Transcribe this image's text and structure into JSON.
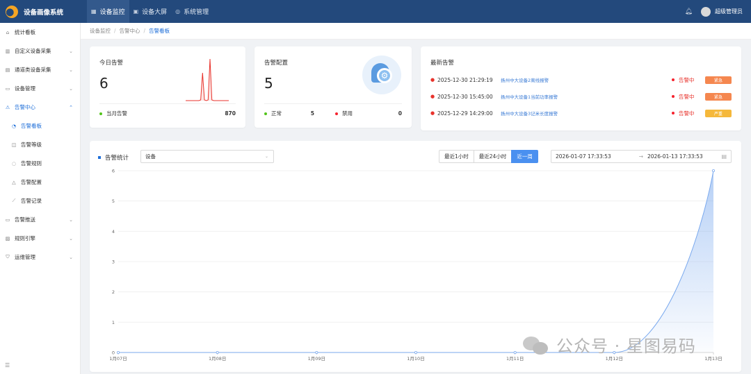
{
  "app": {
    "title": "设备画像系统",
    "user": "超级管理员"
  },
  "nav": [
    {
      "label": "设备监控",
      "icon": "grid-icon",
      "glyph": "▦",
      "active": true
    },
    {
      "label": "设备大屏",
      "icon": "screen-icon",
      "glyph": "▣",
      "active": false
    },
    {
      "label": "系统管理",
      "icon": "settings-icon",
      "glyph": "◎",
      "active": false
    }
  ],
  "sidebar": {
    "items": [
      {
        "label": "统计看板",
        "glyph": "⌂",
        "icon": "home-icon"
      },
      {
        "label": "自定义设备采集",
        "glyph": "▥",
        "icon": "chart-icon",
        "arrow": "⌄"
      },
      {
        "label": "通道类设备采集",
        "glyph": "▤",
        "icon": "table-icon",
        "arrow": "⌄"
      },
      {
        "label": "设备管理",
        "glyph": "▭",
        "icon": "device-icon",
        "arrow": "⌄"
      },
      {
        "label": "告警中心",
        "glyph": "⚠",
        "icon": "alarm-icon",
        "arrow": "⌃",
        "open": true
      },
      {
        "label": "告警看板",
        "glyph": "◔",
        "icon": "dashboard-icon",
        "sub": true,
        "active": true
      },
      {
        "label": "告警等级",
        "glyph": "◫",
        "icon": "level-icon",
        "sub": true
      },
      {
        "label": "告警规则",
        "glyph": "◌",
        "icon": "rule-icon",
        "sub": true
      },
      {
        "label": "告警配置",
        "glyph": "△",
        "icon": "config-icon",
        "sub": true
      },
      {
        "label": "告警记录",
        "glyph": "⟋",
        "icon": "record-icon",
        "sub": true
      },
      {
        "label": "告警推送",
        "glyph": "▭",
        "icon": "push-icon",
        "arrow": "⌄"
      },
      {
        "label": "规则引擎",
        "glyph": "▨",
        "icon": "engine-icon",
        "arrow": "⌄"
      },
      {
        "label": "运维管理",
        "glyph": "⛉",
        "icon": "ops-icon",
        "arrow": "⌄"
      }
    ],
    "collapse_glyph": "☰"
  },
  "breadcrumb": [
    "设备监控",
    "告警中心",
    "告警看板"
  ],
  "today": {
    "title": "今日告警",
    "count": "6",
    "month_label": "当月告警",
    "month_value": "870"
  },
  "config": {
    "title": "告警配置",
    "count": "5",
    "normal_label": "正常",
    "normal_value": "5",
    "disabled_label": "禁用",
    "disabled_value": "0"
  },
  "latest": {
    "title": "最新告警",
    "rows": [
      {
        "time": "2025-12-30 21:29:19",
        "msg": "扬州中大设备2离线报警",
        "status": "告警中",
        "level": "紧急",
        "color": "#f5874f"
      },
      {
        "time": "2025-12-30 15:45:00",
        "msg": "扬州中大设备1当前功率报警",
        "status": "告警中",
        "level": "紧急",
        "color": "#f5874f"
      },
      {
        "time": "2025-12-29 14:29:00",
        "msg": "扬州中大设备3记米长度报警",
        "status": "告警中",
        "level": "严重",
        "color": "#f5b83b"
      }
    ]
  },
  "stats": {
    "title": "告警统计",
    "select_value": "设备",
    "ranges": [
      {
        "label": "最近1小时",
        "active": false
      },
      {
        "label": "最近24小时",
        "active": false
      },
      {
        "label": "近一周",
        "active": true
      }
    ],
    "date_start": "2026-01-07 17:33:53",
    "date_end": "2026-01-13 17:33:53",
    "arrow": "→"
  },
  "chart_data": {
    "type": "area",
    "categories": [
      "1月07日",
      "1月08日",
      "1月09日",
      "1月10日",
      "1月11日",
      "1月12日",
      "1月13日"
    ],
    "values": [
      0,
      0,
      0,
      0,
      0,
      0,
      6
    ],
    "ylim": [
      0,
      6
    ],
    "yticks": [
      0,
      1,
      2,
      3,
      4,
      5,
      6
    ],
    "grid": true,
    "color": "#7aa9ee"
  },
  "spark_data": {
    "type": "line",
    "values": [
      0,
      0,
      0,
      0,
      0,
      0,
      0,
      0,
      0.1,
      4,
      0.1,
      0,
      0.1,
      6,
      0.1,
      0,
      0,
      0,
      0,
      0,
      0,
      0,
      0,
      0
    ],
    "color": "#e8332c"
  },
  "watermark": "公众号 · 星图易码"
}
